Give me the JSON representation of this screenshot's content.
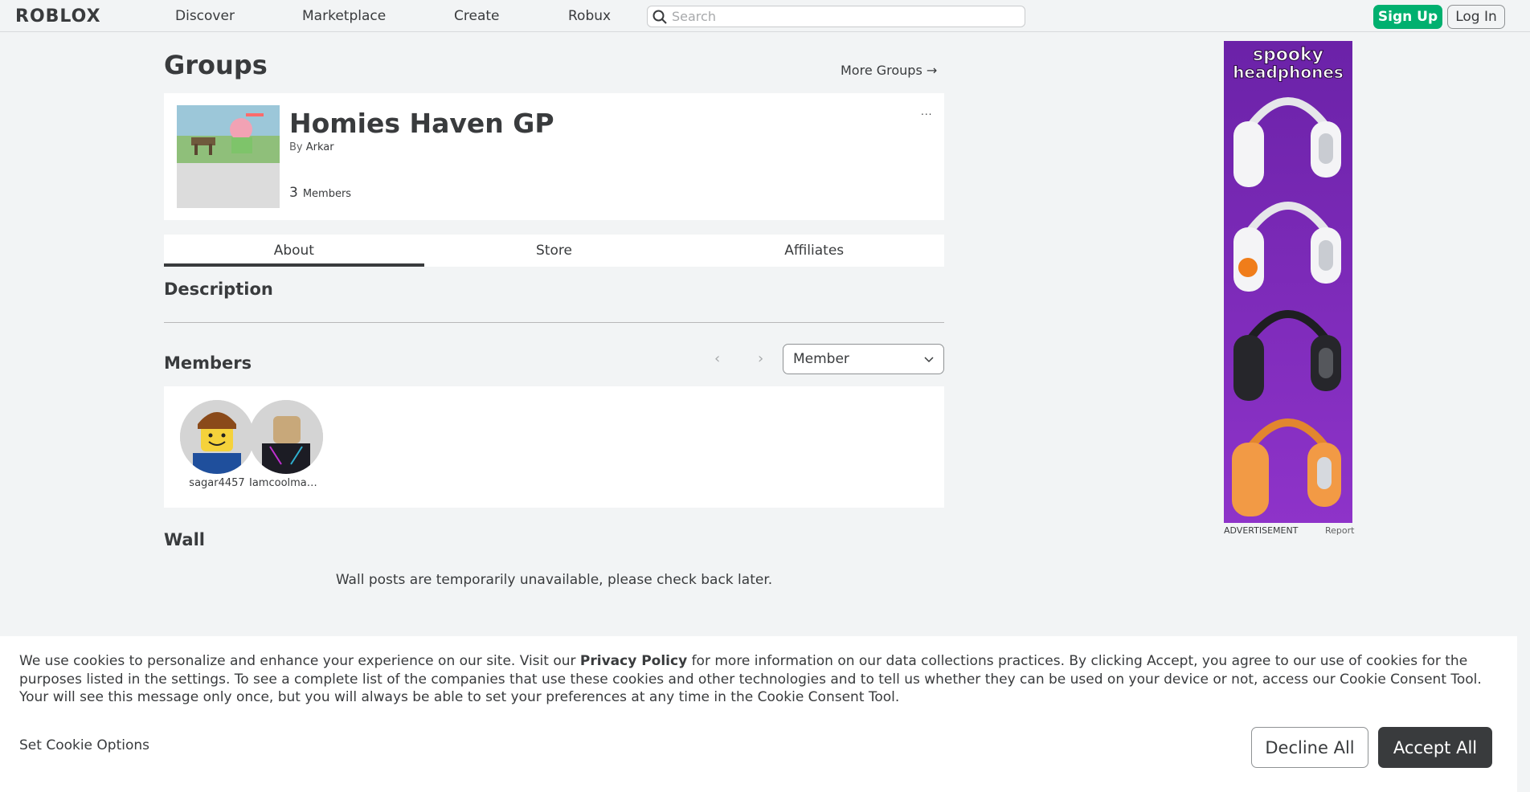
{
  "nav": {
    "logo_text": "ROBLOX",
    "links": [
      "Discover",
      "Marketplace",
      "Create",
      "Robux"
    ],
    "search_placeholder": "Search",
    "signup_label": "Sign Up",
    "login_label": "Log In"
  },
  "page": {
    "title": "Groups",
    "more_groups_label": "More Groups →"
  },
  "group": {
    "name": "Homies Haven GP",
    "by_prefix": "By",
    "owner": "Arkar",
    "member_count": "3",
    "member_count_label": "Members",
    "more_menu": "..."
  },
  "tabs": [
    "About",
    "Store",
    "Affiliates"
  ],
  "sections": {
    "description_heading": "Description",
    "members_heading": "Members",
    "wall_heading": "Wall",
    "wall_message": "Wall posts are temporarily unavailable, please check back later."
  },
  "members": {
    "role_selected": "Member",
    "list": [
      {
        "name": "sagar4457"
      },
      {
        "name": "Iamcoolman..."
      }
    ]
  },
  "ad": {
    "headline_line1": "spooky",
    "headline_line2": "headphones",
    "label": "ADVERTISEMENT",
    "report_label": "Report"
  },
  "cookie": {
    "text_before_link": "We use cookies to personalize and enhance your experience on our site. Visit our ",
    "link_text": "Privacy Policy",
    "text_after_link": " for more information on our data collections practices. By clicking Accept, you agree to our use of cookies for the purposes listed in the settings. To see a complete list of the companies that use these cookies and other technologies and to tell us whether they can be used on your device or not, access our Cookie Consent Tool. Your will see this message only once, but you will always be able to set your preferences at any time in the Cookie Consent Tool.",
    "options_label": "Set Cookie Options",
    "decline_label": "Decline All",
    "accept_label": "Accept All"
  },
  "colors": {
    "signup_green": "#00b06f",
    "ad_purple": "#7a2bb8",
    "accept_dark": "#393b3d"
  }
}
